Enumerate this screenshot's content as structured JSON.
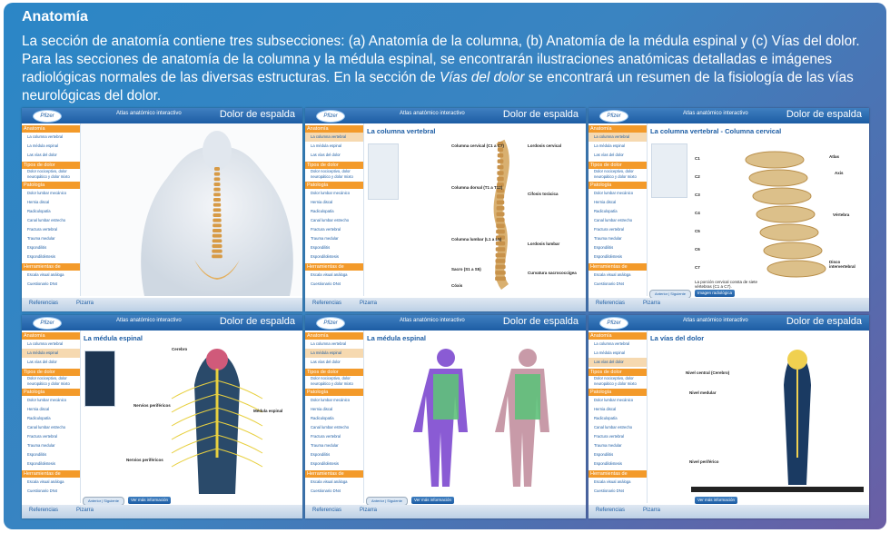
{
  "slide": {
    "title": "Anatomía",
    "intro_a": "La sección de anatomía contiene tres subsecciones: (a) Anatomía de la columna, (b) Anatomía de la médula espinal y (c) Vías del dolor. Para las secciones de anatomía de la columna y la médula espinal, se encontrarán ilustraciones anatómicas detalladas e imágenes radiológicas normales de las diversas estructuras. En la sección de ",
    "intro_em": "Vías del dolor",
    "intro_b": " se encontrará un resumen de la fisiología de las vías neurológicas del dolor."
  },
  "app": {
    "logo": "Pfizer",
    "atlas": "Atlas anatómico interactivo",
    "title": "Dolor de espalda",
    "sections": {
      "anatomia": "Anatomía",
      "tipos": "Tipos de dolor",
      "patologia": "Patología",
      "herramientas": "Herramientas de evaluación del dolor"
    },
    "items": {
      "columna": "La columna vertebral",
      "medula": "La médula espinal",
      "vias": "Las vías del dolor",
      "nocic": "Dolor nociceptivo, dolor neuropático y dolor mixto",
      "lumbar": "Dolor lumbar mecánico",
      "hernia": "Hernia discal",
      "radic": "Radiculopatía",
      "canal": "Canal lumbar estrecho",
      "fractura": "Fractura vertebral",
      "trauma": "Trauma medular",
      "espondilitis": "Espondilitis",
      "espondilolistesis": "Espondilolistesis",
      "escala": "Escala visual análoga",
      "dn4": "Cuestionario DN4"
    },
    "footer": {
      "refs": "Referencias",
      "pizarra": "Pizarra"
    },
    "nav": {
      "prev": "Anterior",
      "next": "Siguiente"
    },
    "buttons": {
      "more": "Ver más información",
      "radio": "Imagen radiológica"
    }
  },
  "panels": {
    "p2": {
      "title": "La columna vertebral",
      "labels": {
        "cervical": "Columna cervical (C1 a C7)",
        "dorsal": "Columna dorsal (T1 a T12)",
        "lumbar": "Columna lumbar (L1 a L5)",
        "sacro": "Sacro (S1 a S5)",
        "coxis": "Cóxis",
        "lordosis_c": "Lordosis cervical",
        "cifosis": "Cifosis torácica",
        "lordosis_l": "Lordosis lumbar",
        "curvatura": "Curvatura sacrococcígea"
      }
    },
    "p3": {
      "title": "La columna vertebral - Columna cervical",
      "labels": {
        "atlas": "Atlas",
        "axis": "Axis",
        "vertebra": "Vértebra",
        "disco": "Disco intervertebral"
      },
      "levels": [
        "C1",
        "C2",
        "C3",
        "C4",
        "C5",
        "C6",
        "C7"
      ],
      "note": "La porción cervical consta de siete vértebras (C1 a C7)."
    },
    "p4": {
      "title": "La médula espinal",
      "labels": {
        "cerebro": "Cerebro",
        "nervios1": "Nervios periféricos",
        "medula": "Médula espinal",
        "nervios2": "Nervios periféricos"
      }
    },
    "p5": {
      "title": "La médula espinal"
    },
    "p6": {
      "title": "La vías del dolor",
      "labels": {
        "central": "Nivel central (Cerebro)",
        "medular": "Nivel medular",
        "periferico": "Nivel periférico"
      }
    }
  }
}
